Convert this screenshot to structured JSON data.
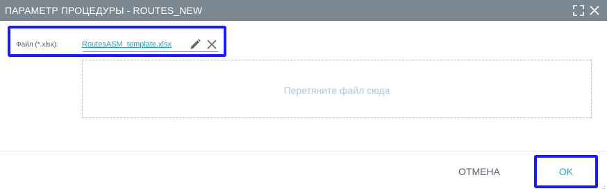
{
  "dialog": {
    "title": "ПАРАМЕТР ПРОЦЕДУРЫ - ROUTES_NEW",
    "icons": {
      "maximize": "maximize-icon",
      "close": "close-icon"
    }
  },
  "file_field": {
    "label": "Файл (*.xlsx):",
    "file_name": "RoutesASM_template.xlsx",
    "icons": {
      "edit": "pencil-icon",
      "remove": "close-icon"
    }
  },
  "dropzone": {
    "hint": "Перетяните файл сюда"
  },
  "footer": {
    "cancel_label": "ОТМЕНА",
    "ok_label": "OK"
  },
  "colors": {
    "titlebar": "#7b8892",
    "highlight": "#1a1aff",
    "link": "#1f9fc7",
    "dropzone_border": "#a7c4dc",
    "dropzone_text": "#a9cbe6",
    "ok_text": "#1fa7c4",
    "cancel_text": "#5b6670"
  }
}
